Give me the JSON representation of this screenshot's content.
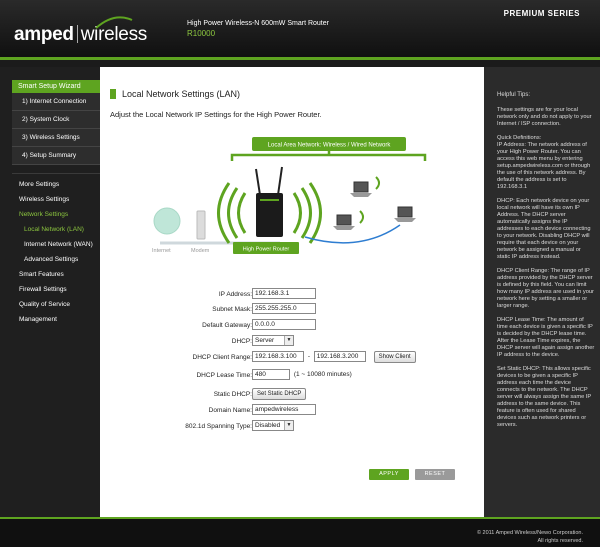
{
  "header": {
    "logo_left": "amped",
    "logo_right": "wireless",
    "product_title": "High Power Wireless-N 600mW Smart Router",
    "model": "R10000",
    "series": "PREMIUM SERIES"
  },
  "sidebar": {
    "wizard_title": "Smart Setup Wizard",
    "wizard_steps": [
      "1) Internet Connection",
      "2) System Clock",
      "3) Wireless Settings",
      "4) Setup Summary"
    ],
    "more_settings": "More Settings",
    "items": [
      {
        "label": "Wireless Settings"
      },
      {
        "label": "Network Settings"
      },
      {
        "label": "Local Network (LAN)"
      },
      {
        "label": "Internet Network (WAN)"
      },
      {
        "label": "Advanced Settings"
      },
      {
        "label": "Smart Features"
      },
      {
        "label": "Firewall Settings"
      },
      {
        "label": "Quality of Service"
      },
      {
        "label": "Management"
      }
    ]
  },
  "main": {
    "title": "Local Network Settings (LAN)",
    "subtitle": "Adjust the Local Network IP Settings for the High Power Router.",
    "diagram": {
      "lan_label": "Local Area Network:  Wireless / Wired Network",
      "internet": "Internet",
      "modem": "Modem",
      "router": "High Power Router"
    },
    "form": {
      "ip_label": "IP Address:",
      "ip_value": "192.168.3.1",
      "mask_label": "Subnet Mask:",
      "mask_value": "255.255.255.0",
      "gateway_label": "Default Gateway:",
      "gateway_value": "0.0.0.0",
      "dhcp_label": "DHCP:",
      "dhcp_value": "Server",
      "range_label": "DHCP Client Range:",
      "range_start": "192.168.3.100",
      "range_sep": "-",
      "range_end": "192.168.3.200",
      "show_client": "Show Client",
      "lease_label": "DHCP Lease Time:",
      "lease_value": "480",
      "lease_hint": "(1 ~ 10080 minutes)",
      "static_label": "Static DHCP:",
      "static_button": "Set Static DHCP",
      "domain_label": "Domain Name:",
      "domain_value": "ampedwireless",
      "stp_label": "802.1d Spanning Type:",
      "stp_value": "Disabled"
    },
    "apply": "APPLY",
    "reset": "RESET"
  },
  "help": {
    "title": "Helpful Tips:",
    "intro": "These settings are for your local network only and do not apply to your Internet / ISP connection.",
    "quick_title": "Quick Definitions:",
    "ip": "IP Address: The network address of your High Power Router.  You can access this web menu by entering setup.ampedwireless.com or through the use of this network address.  By default the address is set to 192.168.3.1",
    "dhcp": "DHCP: Each network device on your local network will have its own IP Address.  The DHCP server automatically assigns the IP addresses to each device connecting to your network.  Disabling DHCP will require that each device on your network be assigned a manual or static IP address instead.",
    "range": "DHCP Client Range:  The range of IP address provided by the DHCP server is defined by this field.  You can limit how many IP address are used in your network here by setting a smaller or larger range.",
    "lease": "DHCP Lease Time: The amount of time each device is given a specific IP is decided by the DHCP lease time.  After the Lease Time expires, the DHCP server will again assign another IP address to the device.",
    "static": "Set Static DHCP: This allows specific devices to be given a specific IP address each time the device connects to the network.  The DHCP server will always assign the same IP address to the same device.  This feature is often used for shared devices such as network printers or servers."
  },
  "footer": {
    "copyright": "© 2011 Amped Wireless/Newo Corporation.",
    "rights": "All rights reserved."
  }
}
